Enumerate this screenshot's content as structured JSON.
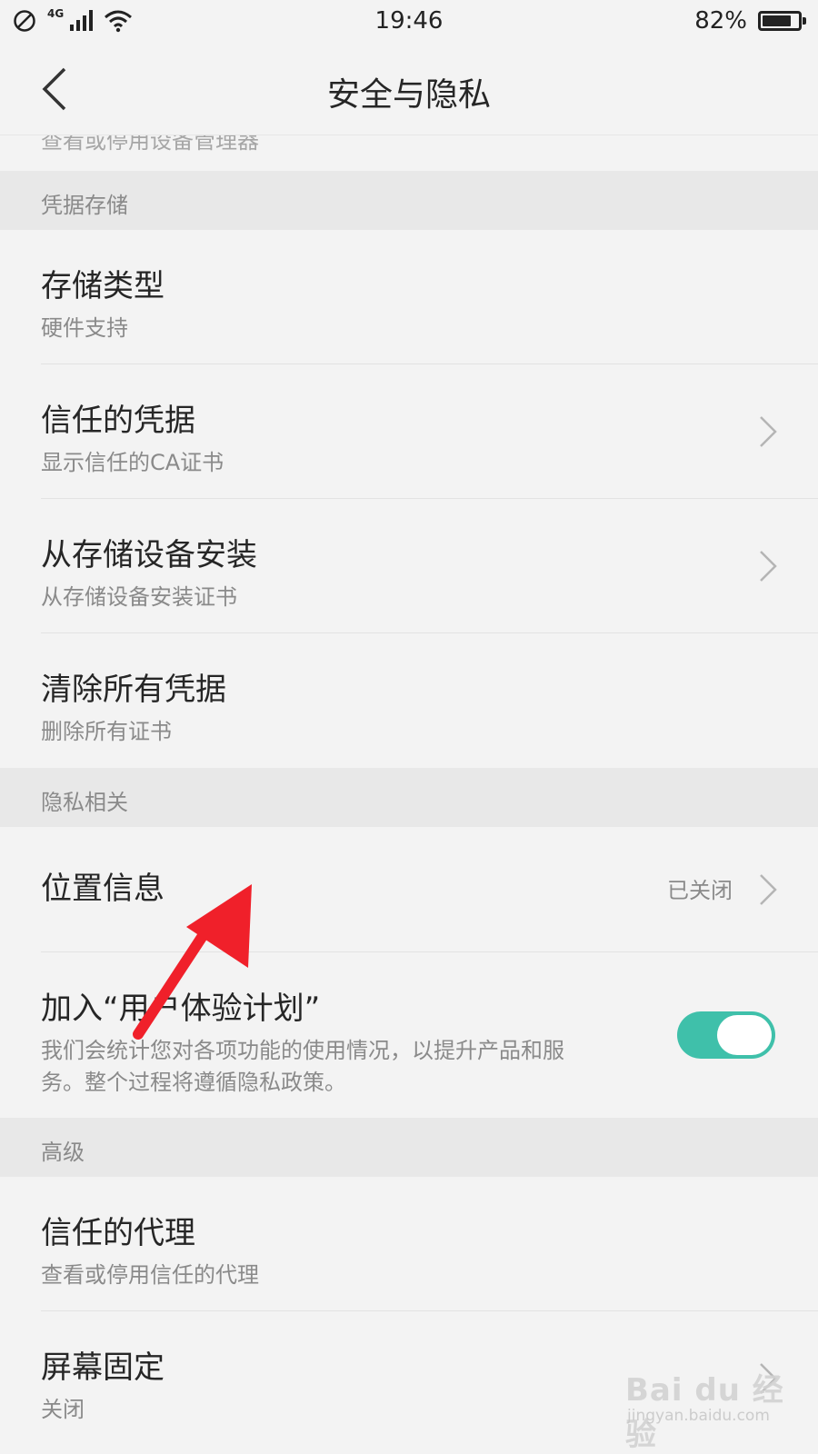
{
  "status_bar": {
    "network": "4G",
    "time": "19:46",
    "battery_percent": "82%",
    "battery_level": 0.82,
    "icons": [
      "no-disturb-icon",
      "signal-icon",
      "wifi-icon",
      "battery-icon"
    ]
  },
  "header": {
    "title": "安全与隐私",
    "back_icon": "chevron-left-icon"
  },
  "cut_off_row": {
    "text": "查看或停用设备管理器"
  },
  "sections": {
    "credential_storage": {
      "header": "凭据存储",
      "rows": [
        {
          "title": "存储类型",
          "subtitle": "硬件支持"
        },
        {
          "title": "信任的凭据",
          "subtitle": "显示信任的CA证书"
        },
        {
          "title": "从存储设备安装",
          "subtitle": "从存储设备安装证书"
        },
        {
          "title": "清除所有凭据",
          "subtitle": "删除所有证书"
        }
      ]
    },
    "privacy": {
      "header": "隐私相关",
      "location": {
        "title": "位置信息",
        "value": "已关闭"
      },
      "ux_plan": {
        "title": "加入“用户体验计划”",
        "subtitle_line1": "我们会统计您对各项功能的使用情况，以提升产品和服",
        "subtitle_line2": "务。整个过程将遵循隐私政策。",
        "enabled": true
      }
    },
    "advanced": {
      "header": "高级",
      "rows": [
        {
          "title": "信任的代理",
          "subtitle": "查看或停用信任的代理"
        },
        {
          "title": "屏幕固定",
          "subtitle": "关闭"
        }
      ]
    }
  },
  "colors": {
    "background": "#f3f3f3",
    "section_header": "#e8e8e8",
    "toggle_on": "#3fc0aa",
    "annotation_arrow": "#f0202a"
  },
  "watermark": {
    "logo": "Bai du 经验",
    "url": "jingyan.baidu.com"
  }
}
